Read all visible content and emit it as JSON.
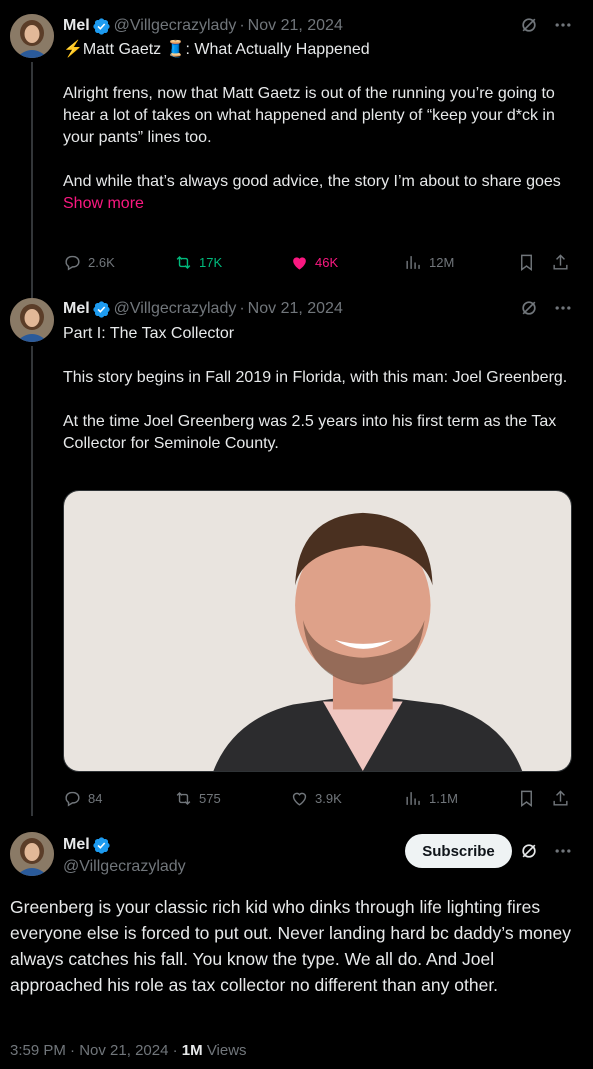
{
  "tweets": [
    {
      "name": "Mel",
      "handle": "@Villgecrazylady",
      "separator": "·",
      "date": "Nov 21, 2024",
      "title": "⚡Matt Gaetz 🧵: What Actually Happened",
      "paragraphs": [
        "Alright frens, now that Matt Gaetz is out of the running you’re going to hear a lot of takes on what happened and plenty of “keep your d*ck in your pants” lines too.",
        "And while that’s always good advice, the story I’m about to share goes"
      ],
      "show_more": "Show more",
      "replies": "2.6K",
      "reposts": "17K",
      "likes": "46K",
      "views": "12M"
    },
    {
      "name": "Mel",
      "handle": "@Villgecrazylady",
      "separator": "·",
      "date": "Nov 21, 2024",
      "title": "Part I: The Tax Collector",
      "paragraphs": [
        "This story begins in Fall 2019 in Florida, with this man: Joel Greenberg.",
        "At the time Joel Greenberg was 2.5 years into his first term as the Tax Collector for Seminole County."
      ],
      "replies": "84",
      "reposts": "575",
      "likes": "3.9K",
      "views": "1.1M"
    }
  ],
  "main_tweet": {
    "name": "Mel",
    "handle": "@Villgecrazylady",
    "subscribe_label": "Subscribe",
    "text": "Greenberg is your classic rich kid who dinks through life lighting fires everyone else is forced to put out. Never landing hard bc daddy’s money always catches his fall. You know the type. We all do. And Joel approached his role as tax collector no different than any other.",
    "time": "3:59 PM",
    "separator": "·",
    "date": "Nov 21, 2024",
    "views_count": "1M",
    "views_label": "Views"
  },
  "colors": {
    "background": "#000000",
    "text": "#e7e9ea",
    "muted": "#71767b",
    "verified": "#1d9bf0",
    "like_active": "#f91880",
    "repost_active": "#00ba7c"
  },
  "icons": [
    "verified-badge-icon",
    "grok-icon",
    "more-icon",
    "reply-icon",
    "repost-icon",
    "like-icon",
    "views-icon",
    "bookmark-icon",
    "share-icon"
  ]
}
